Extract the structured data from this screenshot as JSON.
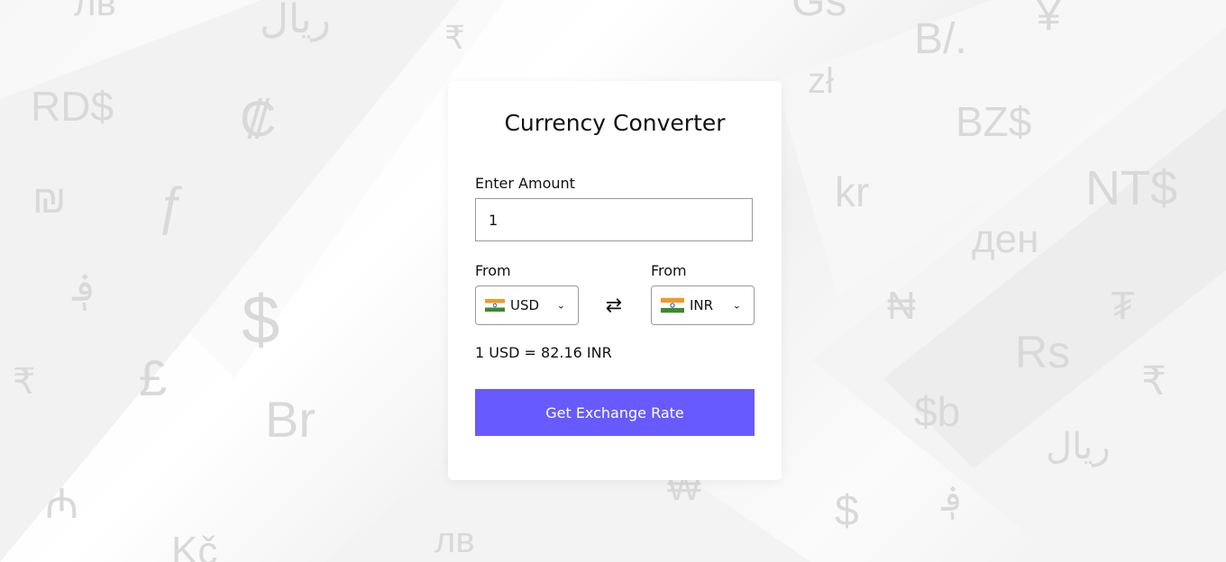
{
  "background": {
    "symbols": [
      "лв",
      "ریال",
      "₹",
      "Gs",
      "B/.",
      "¥",
      "RD$",
      "₡",
      "zł",
      "BZ$",
      "₪",
      "ƒ",
      "kr",
      "NT$",
      "ден",
      "؋",
      "$",
      "₦",
      "₮",
      "Rs",
      "₹",
      "£",
      "Br",
      "$b",
      "₹",
      "ریال",
      "₼",
      "₩",
      "$",
      "؋",
      "Kč",
      "лв"
    ]
  },
  "converter": {
    "title": "Currency Converter",
    "amount_label": "Enter Amount",
    "amount_value": "1",
    "from_label": "From",
    "to_label": "From",
    "from_currency": "USD",
    "to_currency": "INR",
    "swap_icon": "⇄",
    "result_text": "1 USD = 82.16 INR",
    "button_label": "Get Exchange Rate",
    "button_color": "#675afe"
  }
}
